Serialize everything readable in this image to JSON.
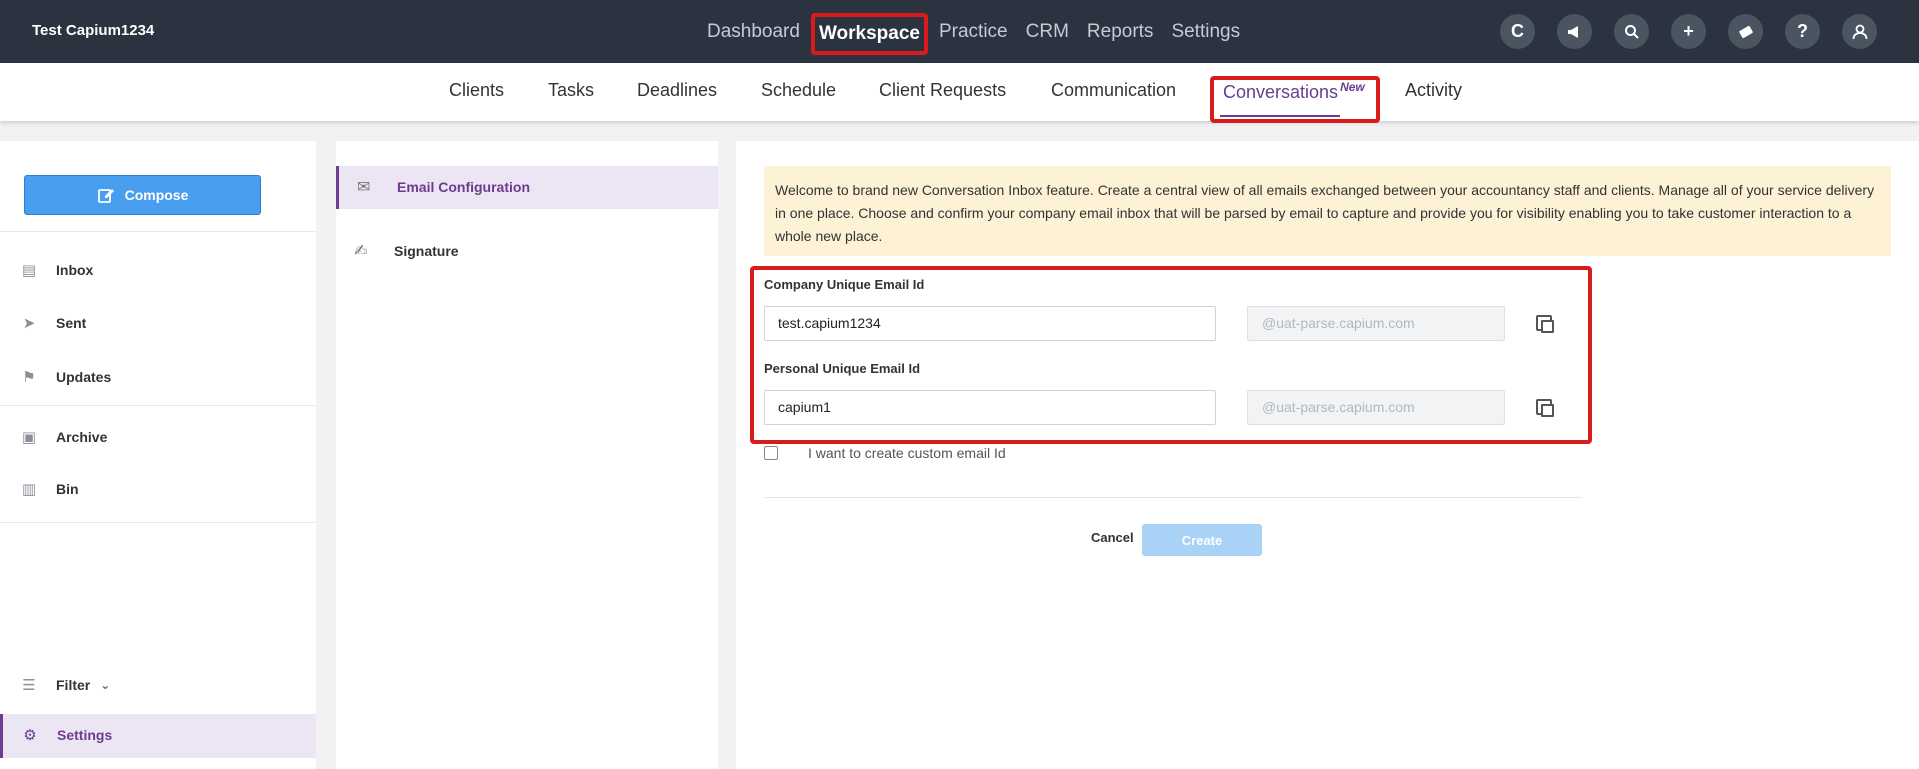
{
  "header": {
    "company": "Test Capium1234",
    "nav": [
      {
        "label": "Dashboard",
        "active": false
      },
      {
        "label": "Workspace",
        "active": true
      },
      {
        "label": "Practice",
        "active": false
      },
      {
        "label": "CRM",
        "active": false
      },
      {
        "label": "Reports",
        "active": false
      },
      {
        "label": "Settings",
        "active": false
      }
    ],
    "icons": [
      "capium-logo-icon",
      "megaphone-icon",
      "search-icon",
      "plus-icon",
      "ticket-icon",
      "help-icon",
      "user-icon"
    ]
  },
  "subnav": {
    "tabs": [
      "Clients",
      "Tasks",
      "Deadlines",
      "Schedule",
      "Client Requests",
      "Communication",
      "Conversations",
      "Activity"
    ],
    "active": "Conversations",
    "new_badge": "New"
  },
  "left": {
    "compose": "Compose",
    "items": [
      {
        "label": "Inbox",
        "icon": "inbox-icon"
      },
      {
        "label": "Sent",
        "icon": "send-icon"
      },
      {
        "label": "Updates",
        "icon": "flag-icon"
      },
      {
        "label": "Archive",
        "icon": "archive-icon"
      },
      {
        "label": "Bin",
        "icon": "trash-icon"
      }
    ],
    "filter": "Filter",
    "settings": "Settings"
  },
  "middle": {
    "items": [
      {
        "label": "Email Configuration",
        "icon": "email-config-icon",
        "active": true
      },
      {
        "label": "Signature",
        "icon": "signature-icon",
        "active": false
      }
    ]
  },
  "main": {
    "notice": "Welcome to brand new Conversation Inbox feature. Create a central view of all emails exchanged between your accountancy staff and clients. Manage all of your service delivery in one place. Choose and confirm your company email inbox that will be parsed by email to capture and provide you for visibility enabling you to take customer interaction to a whole new place.",
    "company_label": "Company Unique Email Id",
    "company_value": "test.capium1234",
    "company_domain": "@uat-parse.capium.com",
    "personal_label": "Personal Unique Email Id",
    "personal_value": "capium1",
    "personal_domain": "@uat-parse.capium.com",
    "custom_checkbox": "I want to create custom email Id",
    "cancel": "Cancel",
    "create": "Create"
  },
  "colors": {
    "topbar": "#2c3340",
    "accent_purple": "#6b3c8f",
    "compose_blue": "#4a9ef0",
    "highlight_red": "#d91b1b",
    "notice_bg": "#fdf2d6"
  }
}
